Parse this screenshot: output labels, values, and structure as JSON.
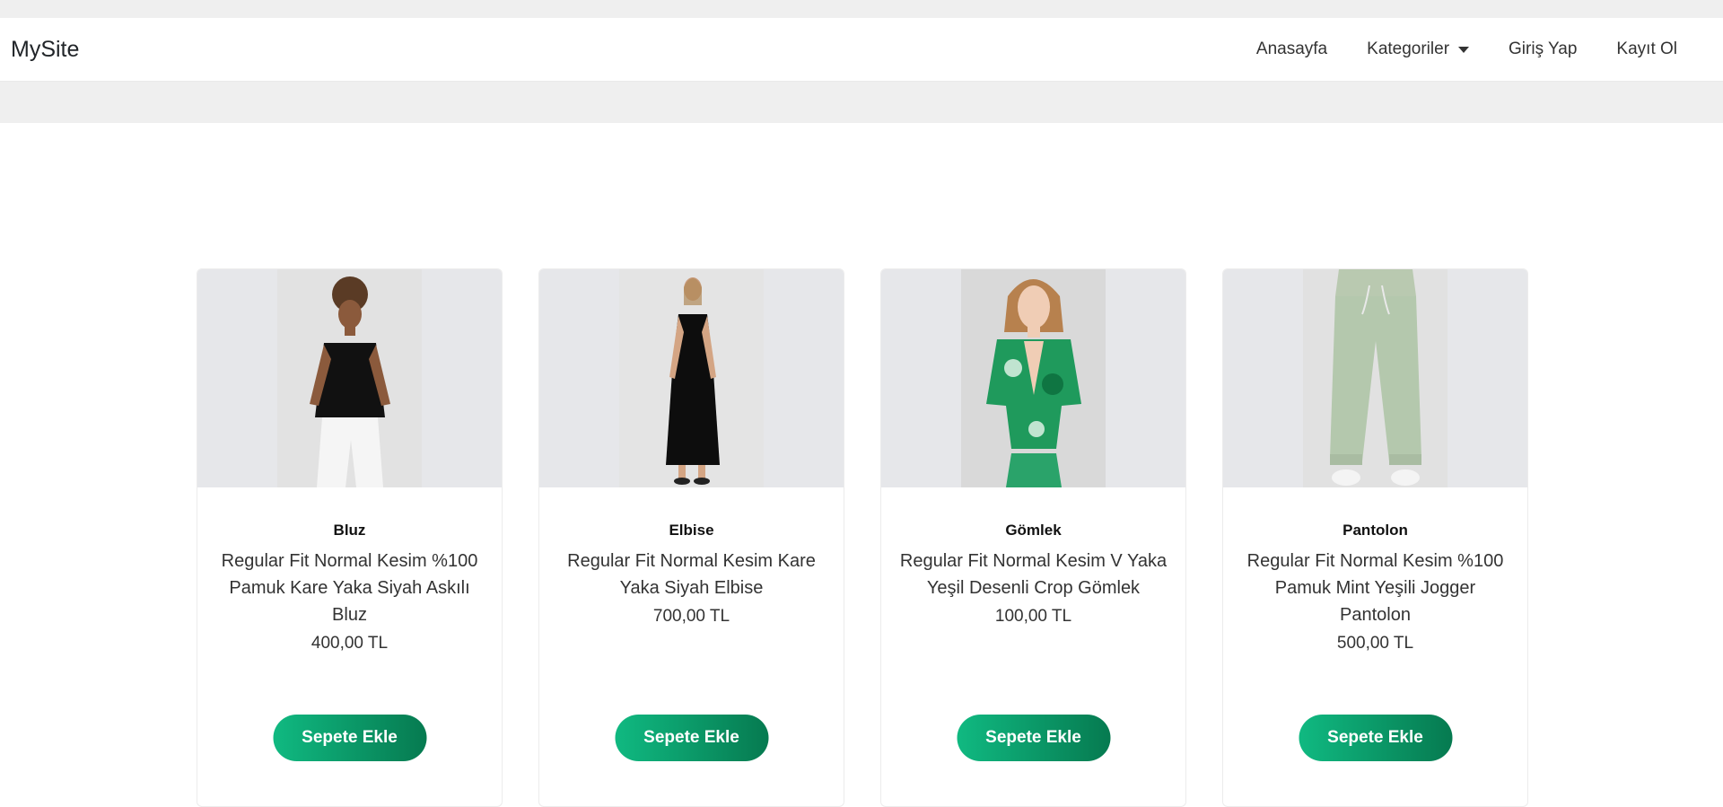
{
  "navbar": {
    "brand": "MySite",
    "links": [
      {
        "label": "Anasayfa"
      },
      {
        "label": "Kategoriler",
        "dropdown": true
      },
      {
        "label": "Giriş Yap"
      },
      {
        "label": "Kayıt Ol"
      }
    ]
  },
  "products": [
    {
      "category": "Bluz",
      "title": "Regular Fit Normal Kesim %100 Pamuk Kare Yaka Siyah Askılı Bluz",
      "price": "400,00 TL",
      "button": "Sepete Ekle"
    },
    {
      "category": "Elbise",
      "title": "Regular Fit Normal Kesim Kare Yaka Siyah Elbise",
      "price": "700,00 TL",
      "button": "Sepete Ekle"
    },
    {
      "category": "Gömlek",
      "title": "Regular Fit Normal Kesim V Yaka Yeşil Desenli Crop Gömlek",
      "price": "100,00 TL",
      "button": "Sepete Ekle"
    },
    {
      "category": "Pantolon",
      "title": "Regular Fit Normal Kesim %100 Pamuk Mint Yeşili Jogger Pantolon",
      "price": "500,00 TL",
      "button": "Sepete Ekle"
    }
  ],
  "colors": {
    "button_start": "#10b981",
    "button_end": "#067a50",
    "band": "#efefef"
  }
}
